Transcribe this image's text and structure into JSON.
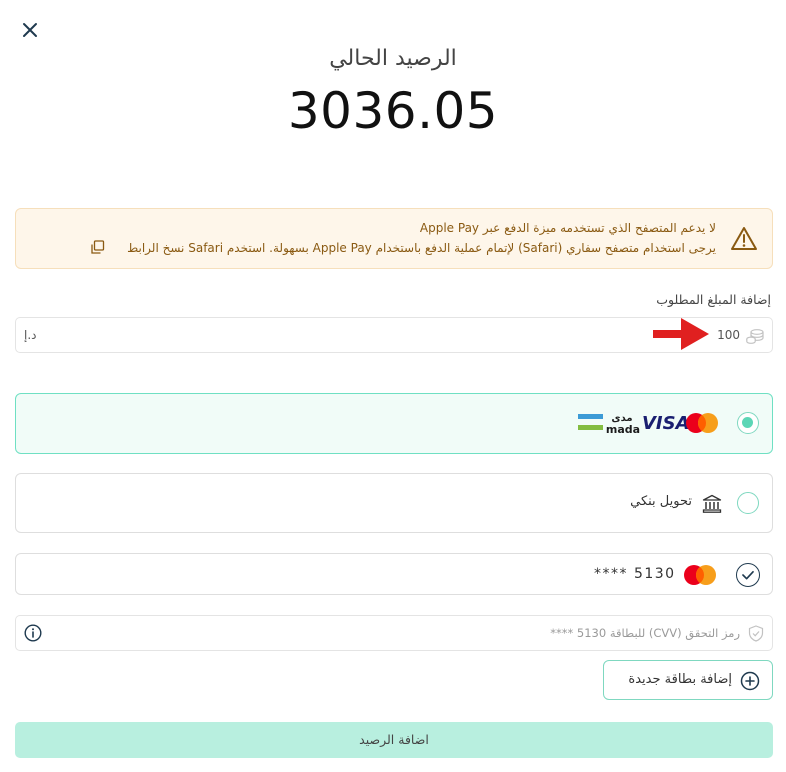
{
  "header": {
    "title": "الرصيد الحالي",
    "balance": "3036.05"
  },
  "warning": {
    "line1": "لا يدعم المتصفح الذي تستخدمه ميزة الدفع عبر Apple Pay",
    "line2": "يرجى استخدام متصفح سفاري (Safari) لإتمام عملية الدفع باستخدام Apple Pay بسهولة. استخدم Safari نسخ الرابط"
  },
  "amount": {
    "label": "إضافة المبلغ المطلوب",
    "value": "100",
    "currency": "د.إ"
  },
  "payment_options": {
    "card_brands": {
      "mada_ar": "مدى",
      "mada_en": "mada",
      "visa": "VISA"
    },
    "bank_transfer_label": "تحويل بنكي",
    "saved_card": "**** 5130",
    "selected": "card"
  },
  "cvv": {
    "placeholder": "رمز التحقق (CVV) للبطاقة 5130 ****"
  },
  "add_card_label": "إضافة بطاقة جديدة",
  "submit_label": "اضافة الرصيد",
  "colors": {
    "accent": "#5cd6b6",
    "submit_bg": "#b8efdf",
    "warning_bg": "#fef6ea",
    "warning_text": "#8a5a12",
    "arrow": "#e02020"
  },
  "icons": [
    "close-icon",
    "warning-icon",
    "copy-icon",
    "coins-icon",
    "bank-icon",
    "mastercard-logo",
    "shield-icon",
    "info-icon",
    "plus-circle-icon"
  ]
}
